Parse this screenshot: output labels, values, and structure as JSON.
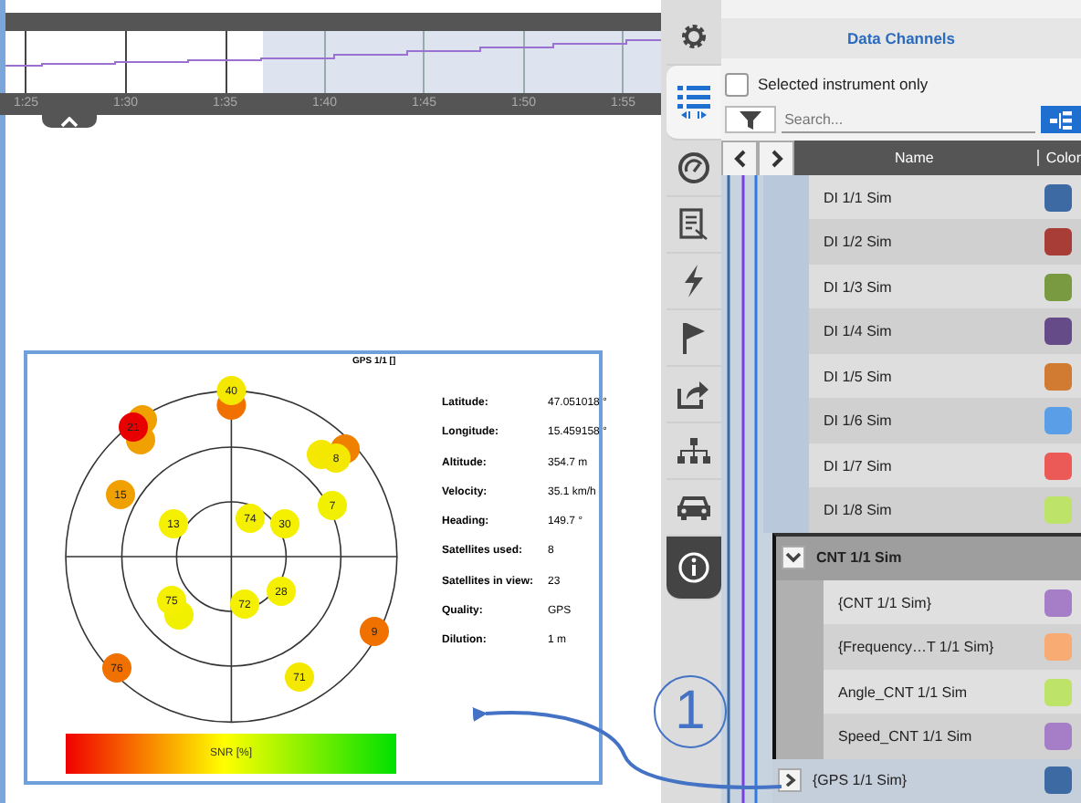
{
  "timeline": {
    "ticks": [
      "1:25",
      "1:30",
      "1:35",
      "1:40",
      "1:45",
      "1:50",
      "1:55"
    ]
  },
  "gps_panel": {
    "title": "GPS 1/1 []",
    "satellites": [
      {
        "color": "#f07000"
      },
      {
        "label": "40",
        "color": "#f5e800"
      },
      {
        "color": "#f0a000"
      },
      {
        "color": "#f0a000"
      },
      {
        "label": "21",
        "color": "#e80000"
      },
      {
        "label": "15",
        "color": "#f0a000"
      },
      {
        "color": "#f08000"
      },
      {
        "color": "#f5e800"
      },
      {
        "label": "8",
        "color": "#f5e800"
      },
      {
        "label": "7",
        "color": "#f0f000"
      },
      {
        "label": "13",
        "color": "#f5f000"
      },
      {
        "label": "74",
        "color": "#f5f000"
      },
      {
        "label": "30",
        "color": "#f5f000"
      },
      {
        "color": "#f0f000"
      },
      {
        "label": "75",
        "color": "#f5f000"
      },
      {
        "label": "72",
        "color": "#f5f000"
      },
      {
        "label": "28",
        "color": "#f5f000"
      },
      {
        "label": "9",
        "color": "#f07000"
      },
      {
        "label": "76",
        "color": "#f07000"
      },
      {
        "label": "71",
        "color": "#f5e800"
      }
    ],
    "info": [
      {
        "label": "Latitude:",
        "value": "47.051018 °"
      },
      {
        "label": "Longitude:",
        "value": "15.459158 °"
      },
      {
        "label": "Altitude:",
        "value": "354.7 m"
      },
      {
        "label": "Velocity:",
        "value": "35.1 km/h"
      },
      {
        "label": "Heading:",
        "value": "149.7 °"
      },
      {
        "label": "Satellites used:",
        "value": "8"
      },
      {
        "label": "Satellites in view:",
        "value": "23"
      },
      {
        "label": "Quality:",
        "value": "GPS"
      },
      {
        "label": "Dilution:",
        "value": "1 m"
      }
    ],
    "legend": "SNR [%]"
  },
  "sidebar": {
    "tabs": [
      {
        "kind": "settings",
        "selected": false,
        "highlighted": false
      },
      {
        "kind": "list",
        "selected": true,
        "highlighted": false
      },
      {
        "kind": "gauge",
        "selected": false,
        "highlighted": false
      },
      {
        "kind": "report",
        "selected": false,
        "highlighted": false
      },
      {
        "kind": "lightning",
        "selected": false,
        "highlighted": false
      },
      {
        "kind": "flag",
        "selected": false,
        "highlighted": false
      },
      {
        "kind": "export",
        "selected": false,
        "highlighted": false
      },
      {
        "kind": "hierarchy",
        "selected": false,
        "highlighted": false
      },
      {
        "kind": "car",
        "selected": false,
        "highlighted": false
      },
      {
        "kind": "info",
        "selected": false,
        "highlighted": true
      }
    ]
  },
  "data_channels": {
    "title": "Data Channels",
    "filter_option": {
      "label": "Selected instrument only",
      "checked": false
    },
    "search": {
      "placeholder": "Search..."
    },
    "columns": [
      "Name",
      "Color"
    ],
    "rows": [
      {
        "kind": "channel",
        "name": "DI 1/1 Sim",
        "color": "#3d6aa3"
      },
      {
        "kind": "channel",
        "name": "DI 1/2 Sim",
        "color": "#a83c36"
      },
      {
        "kind": "channel",
        "name": "DI 1/3 Sim",
        "color": "#7a9a42"
      },
      {
        "kind": "channel",
        "name": "DI 1/4 Sim",
        "color": "#654c88"
      },
      {
        "kind": "channel",
        "name": "DI 1/5 Sim",
        "color": "#d07a32"
      },
      {
        "kind": "channel",
        "name": "DI 1/6 Sim",
        "color": "#5a9ee8"
      },
      {
        "kind": "channel",
        "name": "DI 1/7 Sim",
        "color": "#ec5a58"
      },
      {
        "kind": "channel",
        "name": "DI 1/8 Sim",
        "color": "#bde468"
      },
      {
        "kind": "group",
        "name": "CNT 1/1 Sim",
        "expanded": true,
        "children": [
          {
            "name": "{CNT 1/1 Sim}",
            "color": "#a67ec8"
          },
          {
            "name": "{Frequency…T 1/1 Sim}",
            "color": "#f8ac74"
          },
          {
            "name": "Angle_CNT 1/1 Sim",
            "color": "#bde468"
          },
          {
            "name": "Speed_CNT 1/1 Sim",
            "color": "#a67ec8"
          }
        ]
      },
      {
        "kind": "group",
        "name": "{GPS 1/1 Sim}",
        "expanded": false,
        "color": "#3d6aa3"
      }
    ]
  },
  "annotation": {
    "number": "1"
  }
}
